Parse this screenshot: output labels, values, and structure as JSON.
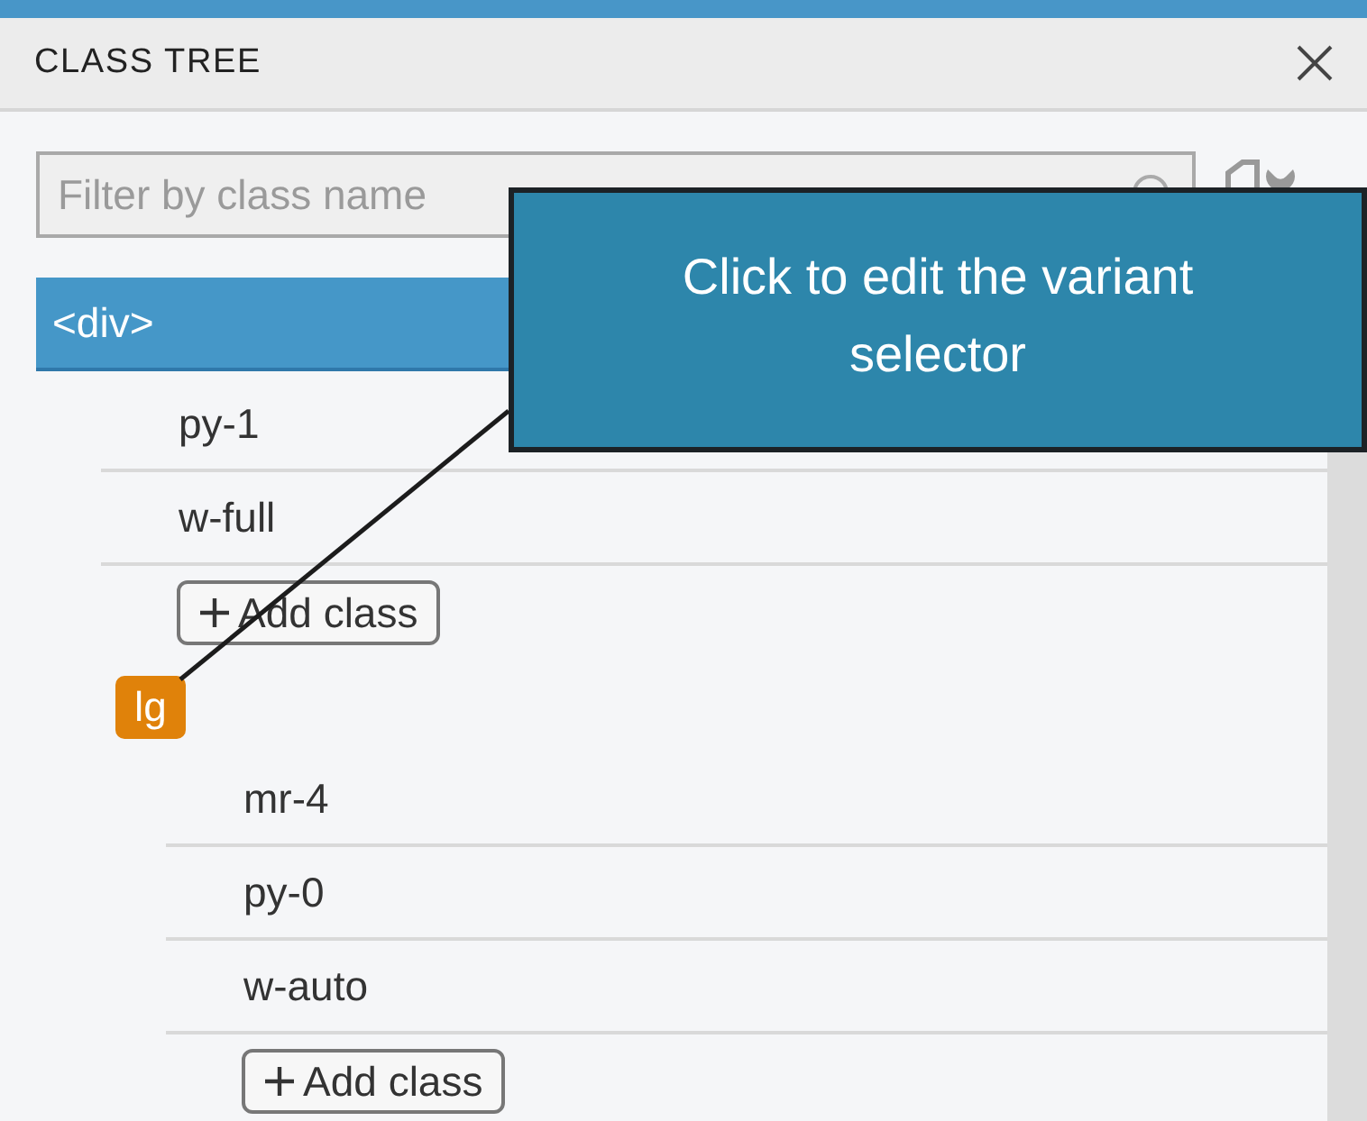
{
  "panel": {
    "title": "CLASS TREE"
  },
  "filter": {
    "placeholder": "Filter by class name"
  },
  "element": {
    "label": "<div>",
    "selected": true
  },
  "classes": [
    "py-1",
    "w-full"
  ],
  "add_button": "Add class",
  "variant": {
    "label": "lg",
    "classes": [
      "mr-4",
      "py-0",
      "w-auto"
    ],
    "add_button": "Add class"
  },
  "callout": {
    "text": "Click to edit the variant selector"
  }
}
